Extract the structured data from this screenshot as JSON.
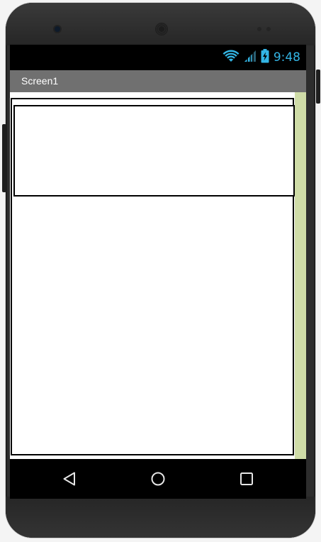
{
  "status_bar": {
    "time": "9:48",
    "icons": [
      "wifi-icon",
      "signal-icon",
      "battery-charging-icon"
    ],
    "accent_color": "#33b5e5"
  },
  "title_bar": {
    "title": "Screen1",
    "background_color": "#707070"
  },
  "content": {
    "scrollbar_color": "#cfdca7"
  },
  "nav_bar": {
    "buttons": [
      "back-icon",
      "home-icon",
      "recent-apps-icon"
    ]
  }
}
